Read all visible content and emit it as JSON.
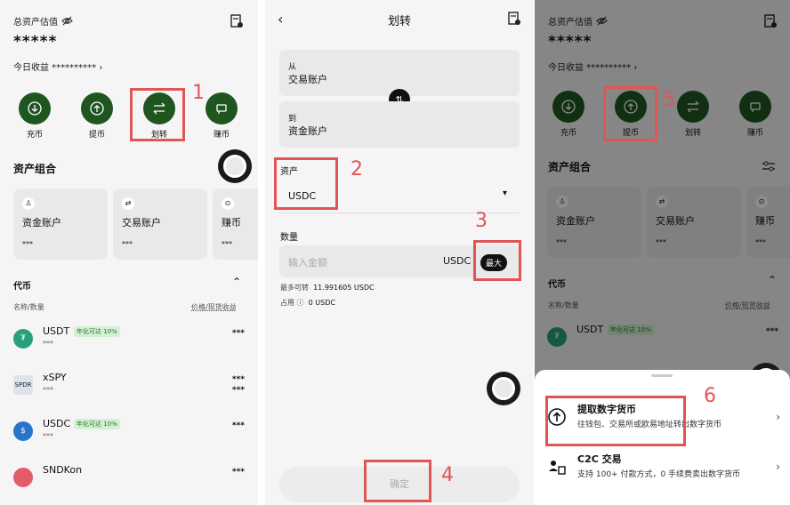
{
  "panel1": {
    "asset_label": "总资产估值",
    "asset_value": "*****",
    "today_label": "今日收益 ********** ›",
    "actions": [
      {
        "label": "充币"
      },
      {
        "label": "提币"
      },
      {
        "label": "划转"
      },
      {
        "label": "赚币"
      }
    ],
    "portfolio_title": "资产组合",
    "cards": [
      {
        "name": "资金账户",
        "value": "***"
      },
      {
        "name": "交易账户",
        "value": "***"
      },
      {
        "name": "赚币",
        "value": "***"
      }
    ],
    "tokens_title": "代币",
    "col_left": "名称/数量",
    "col_right": "价格/现货收益",
    "coins": [
      {
        "symbol": "USDT",
        "badge": "年化可达 10%",
        "sub": "***",
        "price": "***",
        "price2": ""
      },
      {
        "symbol": "xSPY",
        "badge": "",
        "sub": "***",
        "price": "***",
        "price2": "***"
      },
      {
        "symbol": "USDC",
        "badge": "年化可达 10%",
        "sub": "***",
        "price": "***",
        "price2": ""
      },
      {
        "symbol": "SNDKon",
        "badge": "",
        "sub": "",
        "price": "***",
        "price2": ""
      }
    ],
    "markers": {
      "n1": "1"
    }
  },
  "panel2": {
    "title": "划转",
    "from_label": "从",
    "from_value": "交易账户",
    "to_label": "到",
    "to_value": "资金账户",
    "asset_label": "资产",
    "asset_value": "USDC",
    "qty_label": "数量",
    "amount_placeholder": "输入金额",
    "unit": "USDC",
    "max_label": "最大",
    "max_transfer_label": "最多可转",
    "max_transfer_value": "11.991605 USDC",
    "occupied_label": "占用",
    "occupied_value": "0 USDC",
    "confirm_label": "确定",
    "markers": {
      "n2": "2",
      "n3": "3",
      "n4": "4"
    }
  },
  "panel3": {
    "asset_label": "总资产估值",
    "asset_value": "*****",
    "today_label": "今日收益 ********** ›",
    "actions": [
      {
        "label": "充币"
      },
      {
        "label": "提币"
      },
      {
        "label": "划转"
      },
      {
        "label": "赚币"
      }
    ],
    "portfolio_title": "资产组合",
    "cards": [
      {
        "name": "资金账户",
        "value": "***"
      },
      {
        "name": "交易账户",
        "value": "***"
      },
      {
        "name": "赚币",
        "value": "***"
      }
    ],
    "tokens_title": "代币",
    "col_left": "名称/数量",
    "col_right": "价格/现货收益",
    "coins": [
      {
        "symbol": "USDT",
        "badge": "年化可达 10%",
        "price": "***"
      }
    ],
    "sheet": {
      "items": [
        {
          "title": "提取数字货币",
          "desc": "往钱包、交易所或欧易地址转出数字货币"
        },
        {
          "title": "C2C 交易",
          "desc": "支持 100+ 付款方式，0 手续费卖出数字货币"
        }
      ]
    },
    "markers": {
      "n5": "5",
      "n6": "6"
    }
  },
  "colors": {
    "accent_green": "#1f5620",
    "marker_red": "#e05555"
  }
}
